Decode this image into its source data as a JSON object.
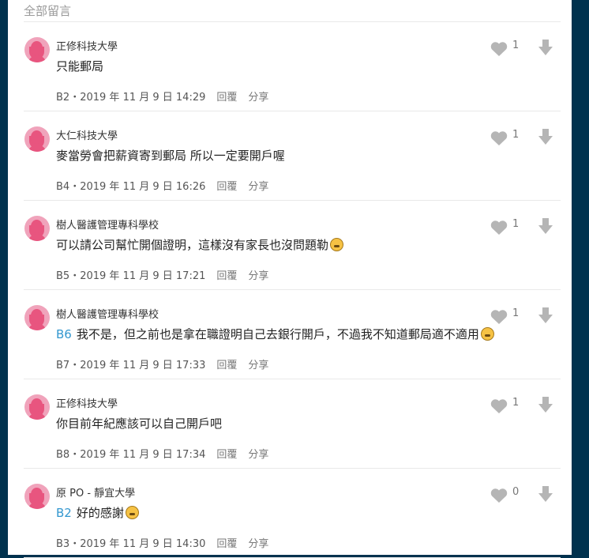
{
  "section": {
    "title": "全部留言"
  },
  "comments": [
    {
      "author": "正修科技大學",
      "text": "只能郵局",
      "mention": "",
      "floor": "B2",
      "time": "2019 年 11 月 9 日 14:29",
      "reply": "回覆",
      "share": "分享",
      "likes": "1",
      "emoji": ""
    },
    {
      "author": "大仁科技大學",
      "text": "麥當勞會把薪資寄到郵局 所以一定要開戶喔",
      "mention": "",
      "floor": "B4",
      "time": "2019 年 11 月 9 日 16:26",
      "reply": "回覆",
      "share": "分享",
      "likes": "1",
      "emoji": ""
    },
    {
      "author": "樹人醫護管理專科學校",
      "text": "可以請公司幫忙開個證明，這樣沒有家長也沒問題勒",
      "mention": "",
      "floor": "B5",
      "time": "2019 年 11 月 9 日 17:21",
      "reply": "回覆",
      "share": "分享",
      "likes": "1",
      "emoji": "grimace-emoji-icon"
    },
    {
      "author": "樹人醫護管理專科學校",
      "text": "我不是，但之前也是拿在職證明自己去銀行開戶，不過我不知道郵局適不適用",
      "mention": "B6",
      "floor": "B7",
      "time": "2019 年 11 月 9 日 17:33",
      "reply": "回覆",
      "share": "分享",
      "likes": "1",
      "emoji": "dizzy-face-emoji-icon"
    },
    {
      "author": "正修科技大學",
      "text": "你目前年紀應該可以自己開戶吧",
      "mention": "",
      "floor": "B8",
      "time": "2019 年 11 月 9 日 17:34",
      "reply": "回覆",
      "share": "分享",
      "likes": "1",
      "emoji": ""
    },
    {
      "author": "原 PO - 靜宜大學",
      "text": "好的感謝",
      "mention": "B2",
      "floor": "B3",
      "time": "2019 年 11 月 9 日 14:30",
      "reply": "回覆",
      "share": "分享",
      "likes": "0",
      "emoji": "crying-face-emoji-icon"
    }
  ],
  "colors": {
    "background": "#00324e",
    "avatar_pink": "#e8557f",
    "mention_blue": "#3397cf",
    "icon_gray": "#b5b5b5"
  }
}
